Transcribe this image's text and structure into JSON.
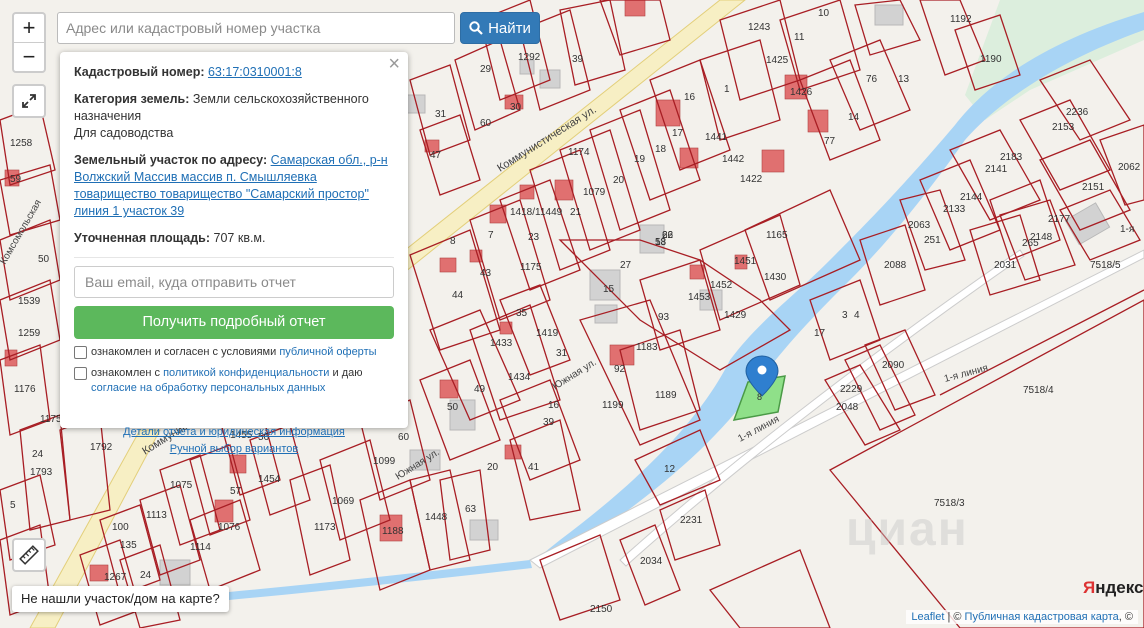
{
  "search": {
    "placeholder": "Адрес или кадастровый номер участка",
    "button_label": "Найти",
    "button_icon": "search-icon"
  },
  "zoom": {
    "in": "+",
    "out": "−"
  },
  "panel": {
    "cadastral_label": "Кадастровый номер:",
    "cadastral_number": "63:17:0310001:8",
    "category_label": "Категория земель:",
    "category_value": "Земли сельскохозяйственного назначения",
    "use_value": "Для садоводства",
    "address_label": "Земельный участок по адресу:",
    "address_value": "Самарская обл., р-н Волжский Массив массив п. Смышляевка товарищество товарищество \"Самарский простор\" линия 1 участок 39",
    "area_label": "Уточненная площадь:",
    "area_value": "707 кв.м.",
    "email_placeholder": "Ваш email, куда отправить отчет",
    "report_button": "Получить подробный отчет",
    "consent1_text": "ознакомлен и согласен с условиями",
    "consent1_link": "публичной оферты",
    "consent2_text": "ознакомлен с",
    "consent2_link": "политикой конфиденциальности",
    "consent2_mid": "и даю",
    "consent2_link2": "согласие на обработку персональных данных",
    "details_link": "Детали отчета и юридическая информация",
    "manual_link": "Ручной выбор вариантов"
  },
  "not_found_button": "Не нашли участок/дом на карте?",
  "attribution": {
    "leaflet": "Leaflet",
    "sep": " | © ",
    "source": "Публичная кадастровая карта",
    "suffix": ", ©"
  },
  "yandex_logo": {
    "letter": "Я",
    "rest": "ндекс"
  },
  "watermark": "циан",
  "map": {
    "streets": [
      "Коммунистическая ул.",
      "Коммунистическая ул.",
      "Южная ул.",
      "Южная ул.",
      "1-я линия",
      "1-я линия",
      "Комсомольская"
    ],
    "selected_parcel_label": "8",
    "parcel_labels": [
      "26",
      "13",
      "27",
      "30",
      "31",
      "29",
      "1292",
      "39",
      "1243",
      "15",
      "50",
      "44",
      "43",
      "1175",
      "23",
      "21",
      "1449",
      "19",
      "20",
      "1079",
      "18",
      "17",
      "16",
      "1",
      "1441",
      "1442",
      "1422",
      "1426",
      "1425",
      "11",
      "10",
      "77",
      "14",
      "76",
      "13",
      "1192",
      "1190",
      "2236",
      "2153",
      "2183",
      "2141",
      "2144",
      "2133",
      "2063",
      "251",
      "2177",
      "2148",
      "265",
      "2031",
      "2151",
      "2062",
      "1165",
      "1430",
      "1429",
      "1453",
      "1452",
      "1451",
      "1183",
      "92",
      "93",
      "1189",
      "1199",
      "1419",
      "1433",
      "1434",
      "35",
      "31",
      "49",
      "50",
      "41",
      "20",
      "39",
      "16",
      "12",
      "2231",
      "2034",
      "2150",
      "2048",
      "2229",
      "2090",
      "17",
      "3",
      "4",
      "2088",
      "7518/4",
      "7518/3",
      "7518/5",
      "1-я",
      "1069",
      "1173",
      "1188",
      "1448",
      "63",
      "1099",
      "60",
      "56",
      "1455",
      "1454",
      "57",
      "1075",
      "1113",
      "1114",
      "1076",
      "5",
      "24",
      "1793",
      "1792",
      "1175",
      "1176",
      "1539",
      "1259",
      "1258",
      "59",
      "60",
      "47",
      "1267",
      "24",
      "100",
      "135",
      "8",
      "7",
      "1418/1",
      "1174",
      "62",
      "58"
    ]
  },
  "colors": {
    "parcel": "#a81e24",
    "water": "#a8d4f5",
    "road": "#f7efc4",
    "highlight": "#8fe089",
    "marker": "#2f7fcf"
  }
}
